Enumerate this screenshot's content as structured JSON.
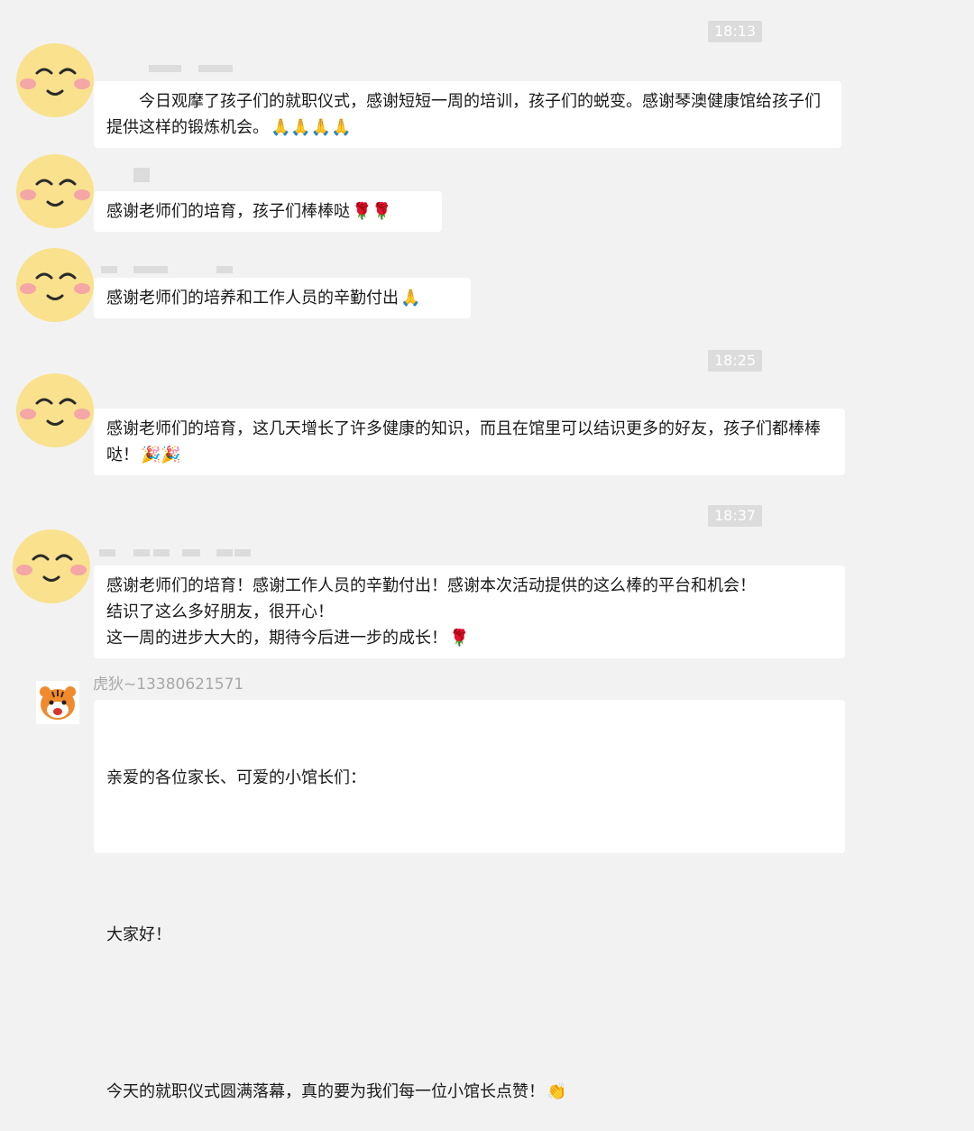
{
  "times": [
    "18:13",
    "18:25",
    "18:37"
  ],
  "messages": [
    {
      "text": "　　今日观摩了孩子们的就职仪式，感谢短短一周的培训，孩子们的蜕变。感谢琴澳健康馆给孩子们提供这样的锻炼机会。",
      "emoji": "🙏🙏🙏🙏"
    },
    {
      "text": "感谢老师们的培育，孩子们棒棒哒",
      "emoji": "🌹🌹"
    },
    {
      "text": "感谢老师们的培养和工作人员的辛勤付出",
      "emoji": "🙏"
    },
    {
      "text": "感谢老师们的培育，这几天增长了许多健康的知识，而且在馆里可以结识更多的好友，孩子们都棒棒哒！",
      "emoji": "🎉🎉"
    },
    {
      "text": "感谢老师们的培育！感谢工作人员的辛勤付出！感谢本次活动提供的这么棒的平台和机会！\n结识了这么多好朋友，很开心！\n这一周的进步大大的，期待今后进一步的成长！",
      "emoji": "🌹"
    }
  ],
  "last_message": {
    "sender": "虎狄~13380621571",
    "line1": "亲爱的各位家长、可爱的小馆长们：",
    "line2": "大家好！",
    "line3": "今天的就职仪式圆满落幕，真的要为我们每一位小馆长点赞！",
    "emoji": "👏"
  }
}
